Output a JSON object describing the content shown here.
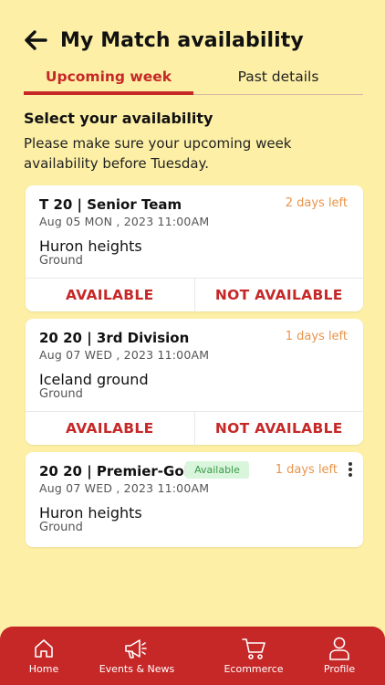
{
  "header": {
    "title": "My Match availability"
  },
  "tabs": [
    {
      "label": "Upcoming week",
      "active": true
    },
    {
      "label": "Past details",
      "active": false
    }
  ],
  "section": {
    "title": "Select your availability",
    "subtitle": "Please make sure your upcoming week availability before Tuesday."
  },
  "matches": [
    {
      "title": "T 20 | Senior Team",
      "days_left": "2 days left",
      "datetime": "Aug 05 MON , 2023  11:00AM",
      "venue": "Huron heights",
      "venue_sub": "Ground",
      "available_label": "AVAILABLE",
      "not_available_label": "NOT AVAILABLE"
    },
    {
      "title": "20 20 | 3rd Division",
      "days_left": "1 days left",
      "datetime": "Aug 07 WED , 2023  11:00AM",
      "venue": "Iceland ground",
      "venue_sub": "Ground",
      "available_label": "AVAILABLE",
      "not_available_label": "NOT AVAILABLE"
    },
    {
      "title": "20 20 | Premier-Gold",
      "status_badge": "Available",
      "days_left": "1 days left",
      "datetime": "Aug 07 WED , 2023  11:00AM",
      "venue": "Huron heights",
      "venue_sub": "Ground"
    }
  ],
  "nav": [
    {
      "label": "Home",
      "icon": "home-icon"
    },
    {
      "label": "Events & News",
      "icon": "megaphone-icon"
    },
    {
      "label": "Ecommerce",
      "icon": "cart-icon"
    },
    {
      "label": "Profile",
      "icon": "user-icon"
    }
  ],
  "colors": {
    "background": "#fdf0a6",
    "accent": "#c62828",
    "days_left": "#e8944a",
    "badge_bg": "#d9f5dc",
    "badge_text": "#3a9a4a"
  }
}
